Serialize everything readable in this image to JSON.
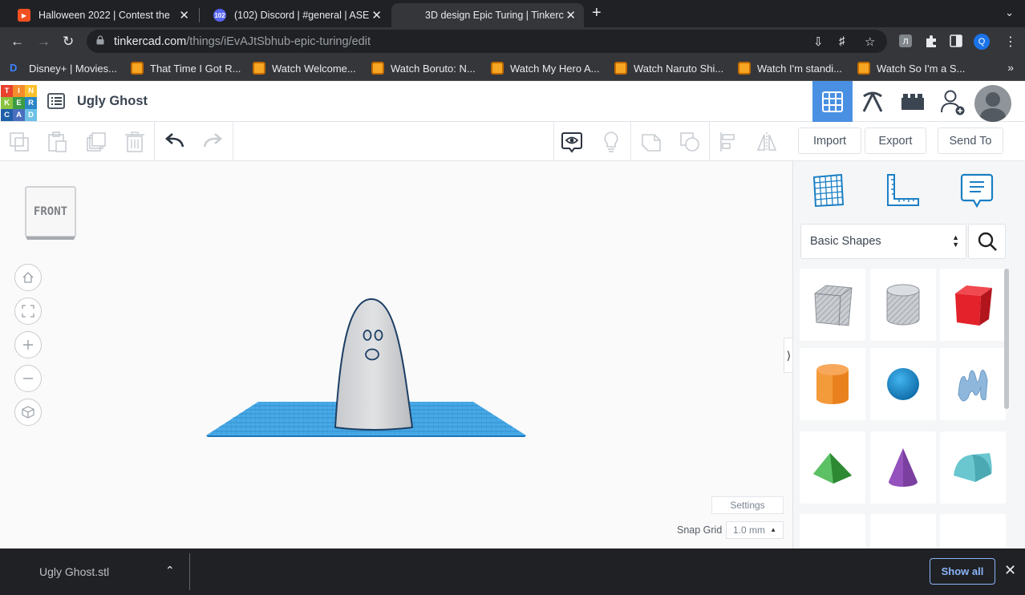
{
  "browser": {
    "tabs": [
      {
        "title": "Halloween 2022 | Contest the",
        "favicon_color": "#f25022"
      },
      {
        "title": "(102) Discord | #general | ASE",
        "favicon_color": "#5865f2",
        "badge": "102"
      },
      {
        "title": "3D design Epic Turing | Tinkerc",
        "favicon_color": "#e6382e",
        "active": true
      }
    ],
    "url_host": "tinkercad.com",
    "url_path": "/things/iEvAJtSbhub-epic-turing/edit",
    "profile_initial": "Q",
    "bookmarks": [
      "Disney+ | Movies...",
      "That Time I Got R...",
      "Watch Welcome...",
      "Watch Boruto: N...",
      "Watch My Hero A...",
      "Watch Naruto Shi...",
      "Watch I'm standi...",
      "Watch So I'm a S..."
    ]
  },
  "app": {
    "logo_letters": [
      "T",
      "I",
      "N",
      "K",
      "E",
      "R",
      "C",
      "A",
      "D"
    ],
    "logo_colors": [
      "#e8412c",
      "#f48c2c",
      "#fbc22d",
      "#8bc23f",
      "#3b9c43",
      "#2a86c6",
      "#1f5fa8",
      "#4a6fbf",
      "#6dc1e6"
    ],
    "design_title": "Ugly Ghost",
    "accent": "#4a90e2"
  },
  "toolbar": {
    "import_label": "Import",
    "export_label": "Export",
    "send_to_label": "Send To"
  },
  "viewcube": {
    "face_label": "FRONT"
  },
  "workplane": {
    "settings_label": "Settings",
    "snap_grid_label": "Snap Grid",
    "snap_grid_value": "1.0 mm"
  },
  "shapes_panel": {
    "category": "Basic Shapes",
    "shapes": [
      {
        "name": "box-hole",
        "color": "#b8bcc4"
      },
      {
        "name": "cylinder-hole",
        "color": "#c8ccd2"
      },
      {
        "name": "box",
        "color": "#e3222b"
      },
      {
        "name": "cylinder",
        "color": "#e9821e"
      },
      {
        "name": "sphere",
        "color": "#1c8fd1"
      },
      {
        "name": "scribble",
        "color": "#8fb7dc"
      },
      {
        "name": "roof",
        "color": "#3aa641"
      },
      {
        "name": "cone",
        "color": "#7b3fa0"
      },
      {
        "name": "round-roof",
        "color": "#6ac6cf"
      }
    ]
  },
  "download_bar": {
    "file_name": "Ugly Ghost.stl",
    "show_all_label": "Show all"
  }
}
